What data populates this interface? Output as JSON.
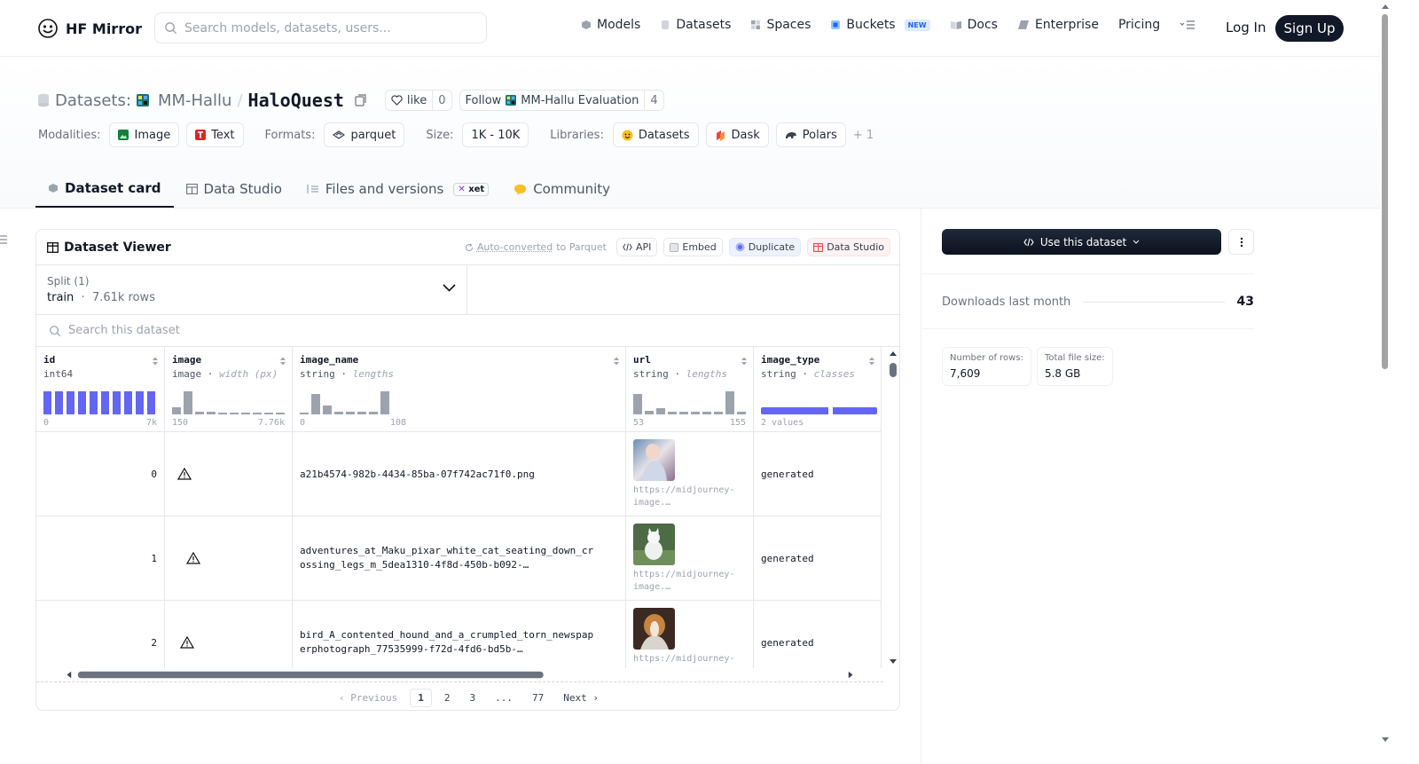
{
  "nav": {
    "brand": "HF Mirror",
    "search_placeholder": "Search models, datasets, users...",
    "links": [
      {
        "label": "Models",
        "icon": "models-icon"
      },
      {
        "label": "Datasets",
        "icon": "datasets-icon"
      },
      {
        "label": "Spaces",
        "icon": "spaces-icon"
      },
      {
        "label": "Buckets",
        "icon": "buckets-icon",
        "badge": "NEW"
      },
      {
        "label": "Docs",
        "icon": "docs-icon"
      },
      {
        "label": "Enterprise",
        "icon": "enterprise-icon"
      },
      {
        "label": "Pricing"
      }
    ],
    "login": "Log In",
    "signup": "Sign Up"
  },
  "repo": {
    "prefix": "Datasets:",
    "owner": "MM-Hallu",
    "name": "HaloQuest",
    "like_label": "like",
    "like_count": "0",
    "follow_label": "Follow",
    "follow_org": "MM-Hallu Evaluation",
    "follow_count": "4"
  },
  "meta": {
    "modalities_label": "Modalities:",
    "modalities": [
      "Image",
      "Text"
    ],
    "formats_label": "Formats:",
    "formats": [
      "parquet"
    ],
    "size_label": "Size:",
    "size": "1K - 10K",
    "libraries_label": "Libraries:",
    "libraries": [
      "Datasets",
      "Dask",
      "Polars"
    ],
    "more": "+ 1"
  },
  "tabs": [
    {
      "label": "Dataset card",
      "active": true
    },
    {
      "label": "Data Studio"
    },
    {
      "label": "Files and versions",
      "badge": "xet"
    },
    {
      "label": "Community"
    }
  ],
  "viewer": {
    "title": "Dataset Viewer",
    "auto_a": "Auto-converted",
    "auto_b": "to Parquet",
    "actions": [
      "API",
      "Embed",
      "Duplicate",
      "Data Studio"
    ],
    "split_label": "Split (1)",
    "split_value": "train",
    "split_rows": "7.61k rows",
    "search_placeholder": "Search this dataset",
    "columns": [
      {
        "name": "id",
        "type": "int64",
        "hint": "",
        "axis_min": "0",
        "axis_max": "7k"
      },
      {
        "name": "image",
        "type": "image",
        "hint": "width (px)",
        "axis_min": "150",
        "axis_max": "7.76k"
      },
      {
        "name": "image_name",
        "type": "string",
        "hint": "lengths",
        "axis_min": "0",
        "axis_max": "108"
      },
      {
        "name": "url",
        "type": "string",
        "hint": "lengths",
        "axis_min": "53",
        "axis_max": "155"
      },
      {
        "name": "image_type",
        "type": "string",
        "hint": "classes",
        "axis_min": "2 values",
        "axis_max": ""
      }
    ],
    "rows": [
      {
        "id": "0",
        "image_name": "a21b4574-982b-4434-85ba-07f742ac71f0.png",
        "url_a": "https://midjourney-",
        "url_b": "image.…",
        "image_type": "generated"
      },
      {
        "id": "1",
        "image_name_a": "adventures_at_Maku_pixar_white_cat_seating_down_cr",
        "image_name_b": "ossing_legs_m_5dea1310-4f8d-450b-b092-…",
        "url_a": "https://midjourney-",
        "url_b": "image.…",
        "image_type": "generated"
      },
      {
        "id": "2",
        "image_name_a": "bird_A_contented_hound_and_a_crumpled_torn_newspap",
        "image_name_b": "erphotograph_77535999-f72d-4fd6-bd5b-…",
        "url_a": "https://midjourney-",
        "image_type": "generated"
      }
    ],
    "pager": {
      "prev": "Previous",
      "pages": [
        "1",
        "2",
        "3",
        "...",
        "77"
      ],
      "next": "Next"
    }
  },
  "side": {
    "use_label": "Use this dataset",
    "downloads_label": "Downloads last month",
    "downloads_value": "43",
    "rows_label": "Number of rows:",
    "rows_value": "7,609",
    "size_label": "Total file size:",
    "size_value": "5.8 GB"
  },
  "histograms": {
    "id": [
      1,
      1,
      1,
      1,
      1,
      1,
      1,
      1,
      1,
      1
    ],
    "image": [
      0.3,
      1,
      0.1,
      0.1,
      0.08,
      0.06,
      0.05,
      0.05,
      0.04,
      0.03
    ],
    "image_name": [
      0.05,
      0.9,
      0.4,
      0.1,
      0.1,
      0.1,
      0.1,
      1
    ],
    "url": [
      0.9,
      0.15,
      0.25,
      0.1,
      0.1,
      0.1,
      0.1,
      0.1,
      1,
      0.1
    ],
    "image_type": [
      0.5,
      0.5
    ]
  },
  "colors": {
    "accent": "#6366f1",
    "bar": "#9ca3af",
    "dark": "#111827"
  }
}
